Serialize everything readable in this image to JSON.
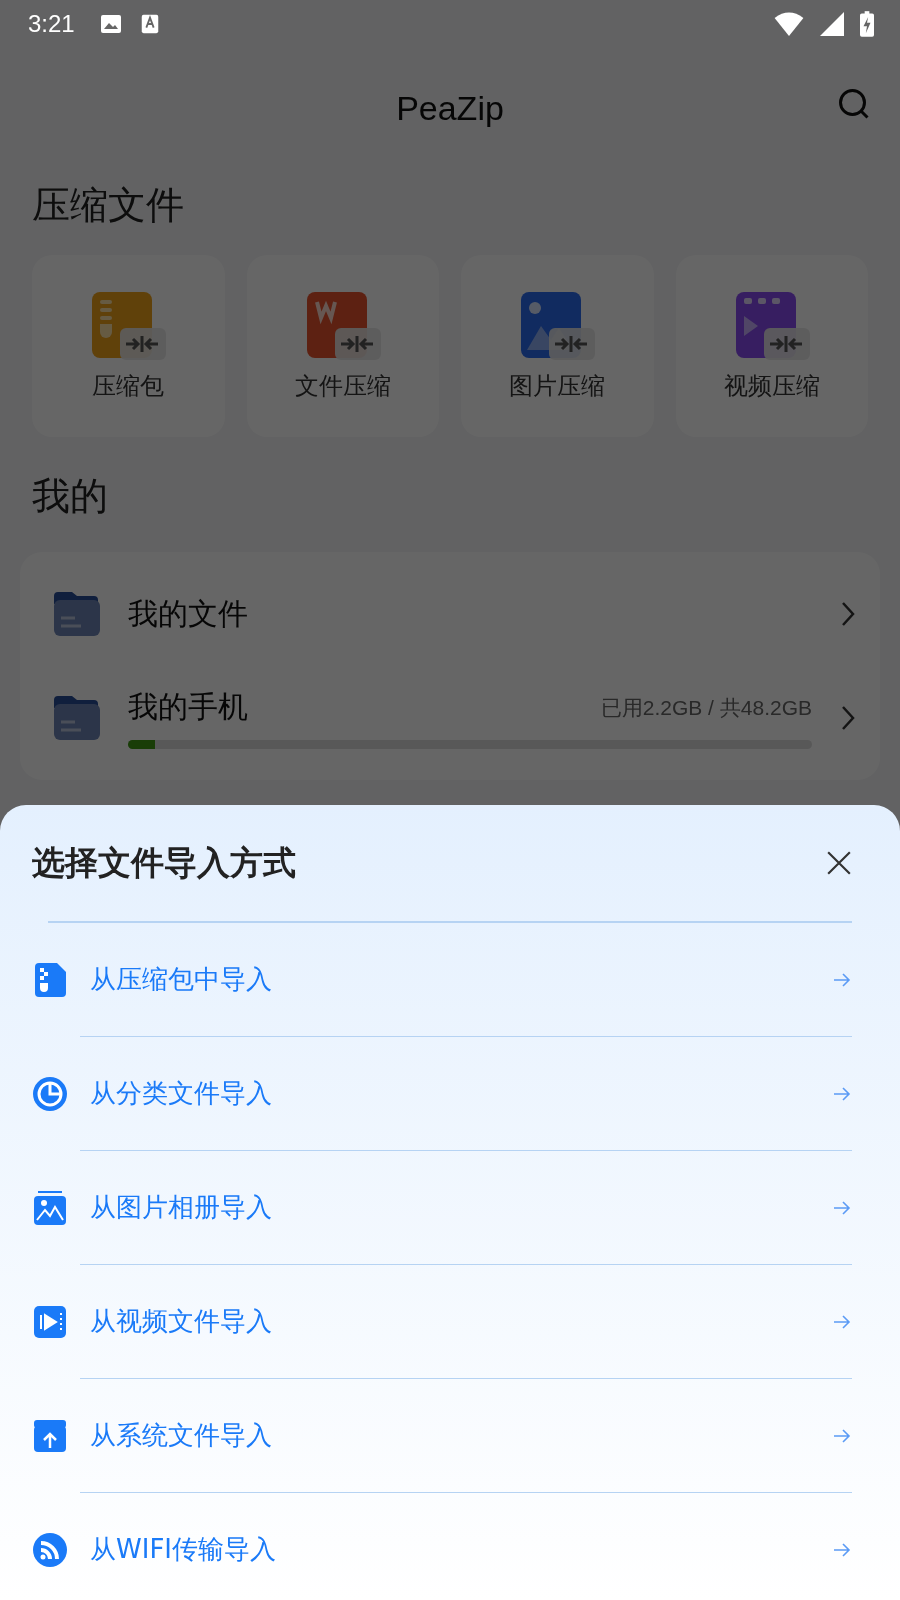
{
  "status_bar": {
    "time": "3:21"
  },
  "app_bar": {
    "title": "PeaZip"
  },
  "compress_section": {
    "title": "压缩文件",
    "tiles": [
      {
        "label": "压缩包",
        "kind": "zip"
      },
      {
        "label": "文件压缩",
        "kind": "doc"
      },
      {
        "label": "图片压缩",
        "kind": "image"
      },
      {
        "label": "视频压缩",
        "kind": "video"
      }
    ]
  },
  "mine_section": {
    "title": "我的",
    "items": [
      {
        "label": "我的文件"
      },
      {
        "label": "我的手机",
        "usage": "已用2.2GB / 共48.2GB",
        "level": 0.04
      }
    ]
  },
  "sheet": {
    "title": "选择文件导入方式",
    "options": [
      {
        "label": "从压缩包中导入",
        "kind": "zip"
      },
      {
        "label": "从分类文件导入",
        "kind": "category"
      },
      {
        "label": "从图片相册导入",
        "kind": "album"
      },
      {
        "label": "从视频文件导入",
        "kind": "video"
      },
      {
        "label": "从系统文件导入",
        "kind": "upload"
      },
      {
        "label": "从WIFI传输导入",
        "kind": "wifi"
      }
    ]
  }
}
